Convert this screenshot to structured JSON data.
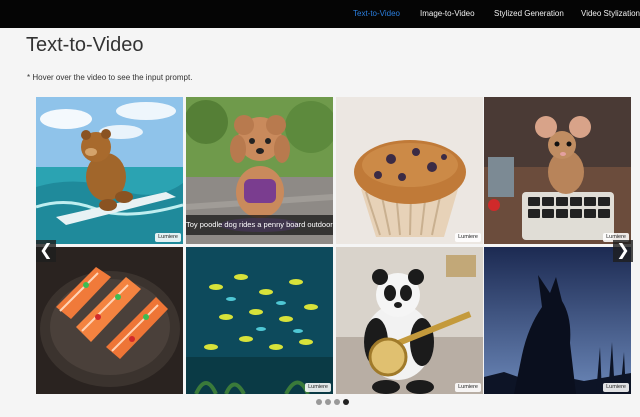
{
  "nav": {
    "items": [
      {
        "label": "Text-to-Video",
        "active": true
      },
      {
        "label": "Image-to-Video",
        "active": false
      },
      {
        "label": "Stylized Generation",
        "active": false
      },
      {
        "label": "Video Stylization",
        "active": false
      }
    ],
    "active_color": "#2b7fe0"
  },
  "page": {
    "title": "Text-to-Video",
    "hint": "* Hover over the video to see the input prompt."
  },
  "gallery": {
    "badge_label": "Lumiere",
    "hover_caption": "Toy poodle dog rides a penny board outdoors",
    "tiles": [
      {
        "subject": "teddy bear surfing"
      },
      {
        "subject": "toy poodle on penny board"
      },
      {
        "subject": "blueberry muffin"
      },
      {
        "subject": "mouse at keyboard"
      },
      {
        "subject": "sushi platter"
      },
      {
        "subject": "school of fish"
      },
      {
        "subject": "panda playing banjo"
      },
      {
        "subject": "wolf silhouette"
      }
    ]
  },
  "controls": {
    "prev_icon": "chevron-left-icon",
    "next_icon": "chevron-right-icon",
    "prev_glyph": "❮",
    "next_glyph": "❯",
    "pages": 4,
    "current_page": 4
  }
}
